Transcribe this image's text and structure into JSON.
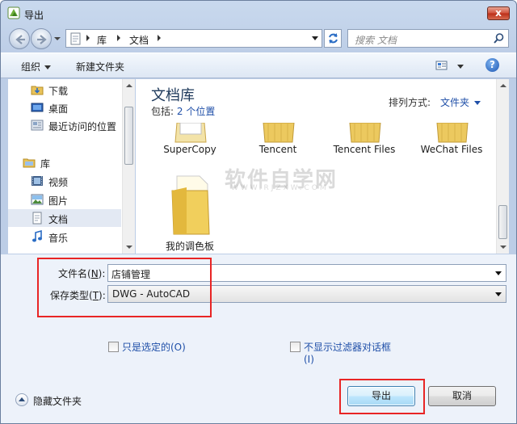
{
  "window": {
    "title": "导出",
    "close_label": "x"
  },
  "address": {
    "crumbs": [
      "库",
      "文档"
    ],
    "search_placeholder": "搜索 文档"
  },
  "toolbar": {
    "organize": "组织",
    "new_folder": "新建文件夹"
  },
  "nav_pane": {
    "items": [
      {
        "label": "下载",
        "icon": "download-folder-icon"
      },
      {
        "label": "桌面",
        "icon": "desktop-icon"
      },
      {
        "label": "最近访问的位置",
        "icon": "recent-places-icon"
      },
      {
        "label": "库",
        "icon": "libraries-icon"
      },
      {
        "label": "视频",
        "icon": "video-icon"
      },
      {
        "label": "图片",
        "icon": "pictures-icon"
      },
      {
        "label": "文档",
        "icon": "documents-icon",
        "selected": true
      },
      {
        "label": "音乐",
        "icon": "music-icon"
      }
    ]
  },
  "content": {
    "library_title": "文档库",
    "includes_label": "包括:",
    "includes_link": "2 个位置",
    "arrange_label": "排列方式:",
    "arrange_value": "文件夹",
    "items": [
      {
        "name": "SuperCopy"
      },
      {
        "name": "Tencent"
      },
      {
        "name": "Tencent Files"
      },
      {
        "name": "WeChat Files"
      },
      {
        "name": "我的调色板"
      }
    ],
    "watermark": "软件自学网",
    "watermark_sub": "WWW.RJZXW.COM"
  },
  "form": {
    "filename_label_pre": "文件名(",
    "filename_label_key": "N",
    "filename_label_post": "):",
    "filename_value": "店铺管理",
    "type_label_pre": "保存类型(",
    "type_label_key": "T",
    "type_label_post": "):",
    "type_value": "DWG - AutoCAD",
    "opt_selected_only": "只是选定的(O)",
    "opt_no_filter_dialog_line1": "不显示过滤器对话框",
    "opt_no_filter_dialog_line2": "(I)",
    "hide_folders": "隐藏文件夹",
    "export_button": "导出",
    "cancel_button": "取消"
  },
  "colors": {
    "highlight": "#e82525",
    "link": "#1f4fa8",
    "title_blue": "#1e395b"
  }
}
